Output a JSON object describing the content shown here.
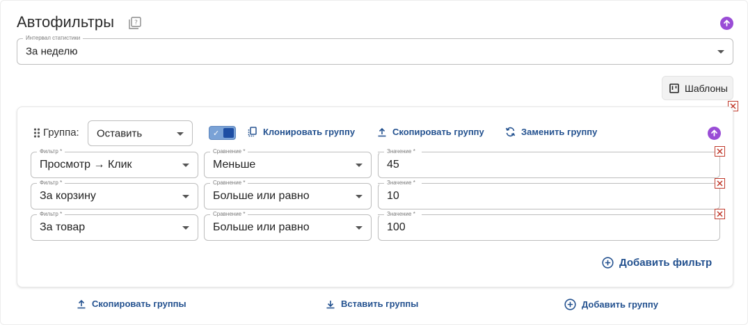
{
  "header": {
    "title": "Автофильтры"
  },
  "interval": {
    "label": "Интервал статистики",
    "value": "За неделю"
  },
  "templates_label": "Шаблоны",
  "group": {
    "label": "Группа:",
    "mode_value": "Оставить",
    "toggle_checked": true,
    "actions": {
      "clone": "Клонировать группу",
      "copy": "Скопировать группу",
      "replace": "Заменить группу"
    },
    "field_labels": {
      "filter": "Фильтр *",
      "compare": "Сравнение *",
      "value": "Значение *"
    },
    "filters": [
      {
        "filter": "Просмотр → Клик",
        "compare": "Меньше",
        "value": "45"
      },
      {
        "filter": "За корзину",
        "compare": "Больше или равно",
        "value": "10"
      },
      {
        "filter": "За товар",
        "compare": "Больше или равно",
        "value": "100"
      }
    ],
    "add_filter": "Добавить фильтр"
  },
  "footer": {
    "copy_groups": "Скопировать группы",
    "paste_groups": "Вставить группы",
    "add_group": "Добавить группу"
  },
  "colors": {
    "accent": "#23518f",
    "purple": "#9a4dd6",
    "danger": "#c0392b"
  }
}
